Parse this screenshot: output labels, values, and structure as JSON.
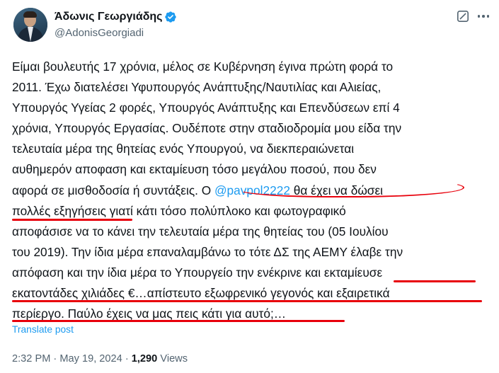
{
  "author": {
    "name": "Άδωνις Γεωργιάδης",
    "handle": "@AdonisGeorgiadi"
  },
  "tweet": {
    "lines": [
      "Είμαι βουλευτής 17 χρόνια, μέλος σε Κυβέρνηση έγινα πρώτη φορά το",
      "2011. Έχω διατελέσει Υφυπουργός Ανάπτυξης/Ναυτιλίας και Αλιείας,",
      "Υπουργός Υγείας 2 φορές, Υπουργός Ανάπτυξης και Επενδύσεων επί 4",
      "χρόνια, Υπουργός Εργασίας.  Ουδέποτε στην σταδιοδρομία μου είδα την",
      "τελευταία μέρα της θητείας ενός Υπουργού, να διεκπεραιώνεται",
      "αυθημερόν αποφαση και εκταμίευση τόσο μεγάλου ποσού, που δεν"
    ],
    "line7_before": "αφορά σε μισθοδοσία ή συντάξεις. Ο ",
    "mention": "@pavpol2222",
    "line7_after": " θα έχει να δώσει",
    "lines_rest": [
      "πολλές εξηγήσεις γιατί κάτι τόσο πολύπλοκο και φωτογραφικό",
      "αποφάσισε να το κάνει την τελευταία μέρα της θητείας του (05 Ιουλίου",
      "του 2019). Την ίδια μέρα επαναλαμβάνω το τότε ΔΣ της ΑΕΜΥ έλαβε την",
      "απόφαση και την ίδια μέρα το Υπουργείο την ενέκρινε και εκταμίευσε",
      "εκατοντάδες χιλιάδες €…απίστευτο εξωφρενικό γεγονός και εξαιρετικά",
      "περίεργο. Παύλο έχεις να μας πεις κάτι για αυτό;…"
    ]
  },
  "translate_label": "Translate post",
  "meta": {
    "time": "2:32 PM",
    "separator": " · ",
    "date": "May 19, 2024",
    "views_count": "1,290",
    "views_label": " Views"
  },
  "icons": {
    "verified": "verified-badge-icon",
    "grok": "grok-icon",
    "more": "more-options-icon"
  },
  "colors": {
    "link": "#1d9bf0",
    "secondary_text": "#536471",
    "primary_text": "#0f1419",
    "annotation_red": "#e8000b"
  }
}
